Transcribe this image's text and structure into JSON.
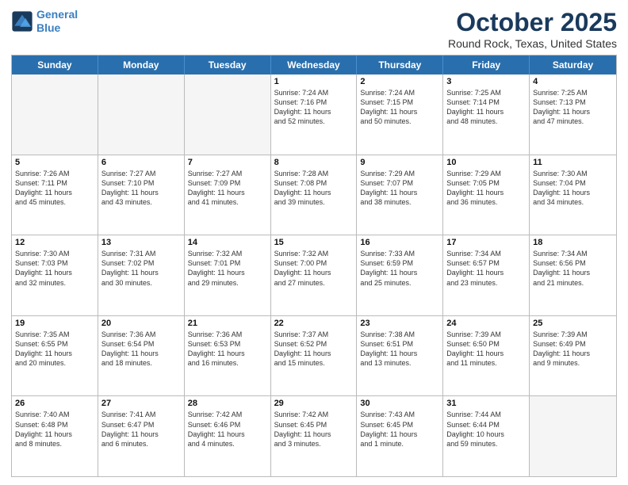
{
  "header": {
    "logo_line1": "General",
    "logo_line2": "Blue",
    "month_title": "October 2025",
    "location": "Round Rock, Texas, United States"
  },
  "day_headers": [
    "Sunday",
    "Monday",
    "Tuesday",
    "Wednesday",
    "Thursday",
    "Friday",
    "Saturday"
  ],
  "rows": [
    [
      {
        "date": "",
        "info": ""
      },
      {
        "date": "",
        "info": ""
      },
      {
        "date": "",
        "info": ""
      },
      {
        "date": "1",
        "info": "Sunrise: 7:24 AM\nSunset: 7:16 PM\nDaylight: 11 hours\nand 52 minutes."
      },
      {
        "date": "2",
        "info": "Sunrise: 7:24 AM\nSunset: 7:15 PM\nDaylight: 11 hours\nand 50 minutes."
      },
      {
        "date": "3",
        "info": "Sunrise: 7:25 AM\nSunset: 7:14 PM\nDaylight: 11 hours\nand 48 minutes."
      },
      {
        "date": "4",
        "info": "Sunrise: 7:25 AM\nSunset: 7:13 PM\nDaylight: 11 hours\nand 47 minutes."
      }
    ],
    [
      {
        "date": "5",
        "info": "Sunrise: 7:26 AM\nSunset: 7:11 PM\nDaylight: 11 hours\nand 45 minutes."
      },
      {
        "date": "6",
        "info": "Sunrise: 7:27 AM\nSunset: 7:10 PM\nDaylight: 11 hours\nand 43 minutes."
      },
      {
        "date": "7",
        "info": "Sunrise: 7:27 AM\nSunset: 7:09 PM\nDaylight: 11 hours\nand 41 minutes."
      },
      {
        "date": "8",
        "info": "Sunrise: 7:28 AM\nSunset: 7:08 PM\nDaylight: 11 hours\nand 39 minutes."
      },
      {
        "date": "9",
        "info": "Sunrise: 7:29 AM\nSunset: 7:07 PM\nDaylight: 11 hours\nand 38 minutes."
      },
      {
        "date": "10",
        "info": "Sunrise: 7:29 AM\nSunset: 7:05 PM\nDaylight: 11 hours\nand 36 minutes."
      },
      {
        "date": "11",
        "info": "Sunrise: 7:30 AM\nSunset: 7:04 PM\nDaylight: 11 hours\nand 34 minutes."
      }
    ],
    [
      {
        "date": "12",
        "info": "Sunrise: 7:30 AM\nSunset: 7:03 PM\nDaylight: 11 hours\nand 32 minutes."
      },
      {
        "date": "13",
        "info": "Sunrise: 7:31 AM\nSunset: 7:02 PM\nDaylight: 11 hours\nand 30 minutes."
      },
      {
        "date": "14",
        "info": "Sunrise: 7:32 AM\nSunset: 7:01 PM\nDaylight: 11 hours\nand 29 minutes."
      },
      {
        "date": "15",
        "info": "Sunrise: 7:32 AM\nSunset: 7:00 PM\nDaylight: 11 hours\nand 27 minutes."
      },
      {
        "date": "16",
        "info": "Sunrise: 7:33 AM\nSunset: 6:59 PM\nDaylight: 11 hours\nand 25 minutes."
      },
      {
        "date": "17",
        "info": "Sunrise: 7:34 AM\nSunset: 6:57 PM\nDaylight: 11 hours\nand 23 minutes."
      },
      {
        "date": "18",
        "info": "Sunrise: 7:34 AM\nSunset: 6:56 PM\nDaylight: 11 hours\nand 21 minutes."
      }
    ],
    [
      {
        "date": "19",
        "info": "Sunrise: 7:35 AM\nSunset: 6:55 PM\nDaylight: 11 hours\nand 20 minutes."
      },
      {
        "date": "20",
        "info": "Sunrise: 7:36 AM\nSunset: 6:54 PM\nDaylight: 11 hours\nand 18 minutes."
      },
      {
        "date": "21",
        "info": "Sunrise: 7:36 AM\nSunset: 6:53 PM\nDaylight: 11 hours\nand 16 minutes."
      },
      {
        "date": "22",
        "info": "Sunrise: 7:37 AM\nSunset: 6:52 PM\nDaylight: 11 hours\nand 15 minutes."
      },
      {
        "date": "23",
        "info": "Sunrise: 7:38 AM\nSunset: 6:51 PM\nDaylight: 11 hours\nand 13 minutes."
      },
      {
        "date": "24",
        "info": "Sunrise: 7:39 AM\nSunset: 6:50 PM\nDaylight: 11 hours\nand 11 minutes."
      },
      {
        "date": "25",
        "info": "Sunrise: 7:39 AM\nSunset: 6:49 PM\nDaylight: 11 hours\nand 9 minutes."
      }
    ],
    [
      {
        "date": "26",
        "info": "Sunrise: 7:40 AM\nSunset: 6:48 PM\nDaylight: 11 hours\nand 8 minutes."
      },
      {
        "date": "27",
        "info": "Sunrise: 7:41 AM\nSunset: 6:47 PM\nDaylight: 11 hours\nand 6 minutes."
      },
      {
        "date": "28",
        "info": "Sunrise: 7:42 AM\nSunset: 6:46 PM\nDaylight: 11 hours\nand 4 minutes."
      },
      {
        "date": "29",
        "info": "Sunrise: 7:42 AM\nSunset: 6:45 PM\nDaylight: 11 hours\nand 3 minutes."
      },
      {
        "date": "30",
        "info": "Sunrise: 7:43 AM\nSunset: 6:45 PM\nDaylight: 11 hours\nand 1 minute."
      },
      {
        "date": "31",
        "info": "Sunrise: 7:44 AM\nSunset: 6:44 PM\nDaylight: 10 hours\nand 59 minutes."
      },
      {
        "date": "",
        "info": ""
      }
    ]
  ]
}
